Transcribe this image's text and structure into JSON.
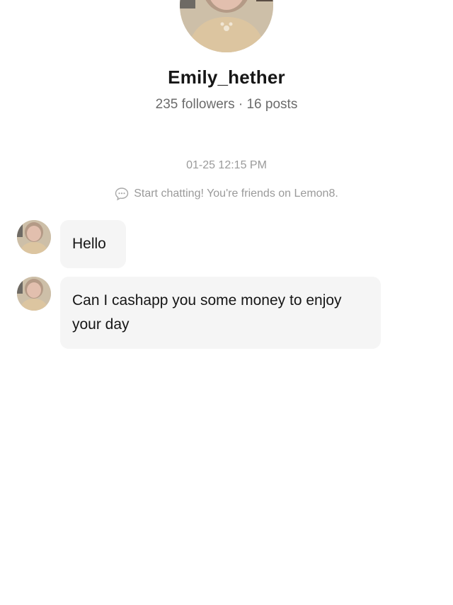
{
  "profile": {
    "username": "Emily_hether",
    "stats": "235 followers · 16 posts",
    "photo_icon": "profile-photo"
  },
  "chat": {
    "timestamp": "01-25 12:15 PM",
    "system_note": "Start chatting! You're friends on Lemon8.",
    "system_note_icon": "chat-bubble-icon",
    "messages": [
      {
        "sender": "Emily_hether",
        "text": "Hello"
      },
      {
        "sender": "Emily_hether",
        "text": "Can I cashapp you some money to enjoy your day"
      }
    ]
  },
  "colors": {
    "background": "#ffffff",
    "bubble": "#f5f5f5",
    "muted_text": "#9a9a9a",
    "primary_text": "#161616"
  }
}
